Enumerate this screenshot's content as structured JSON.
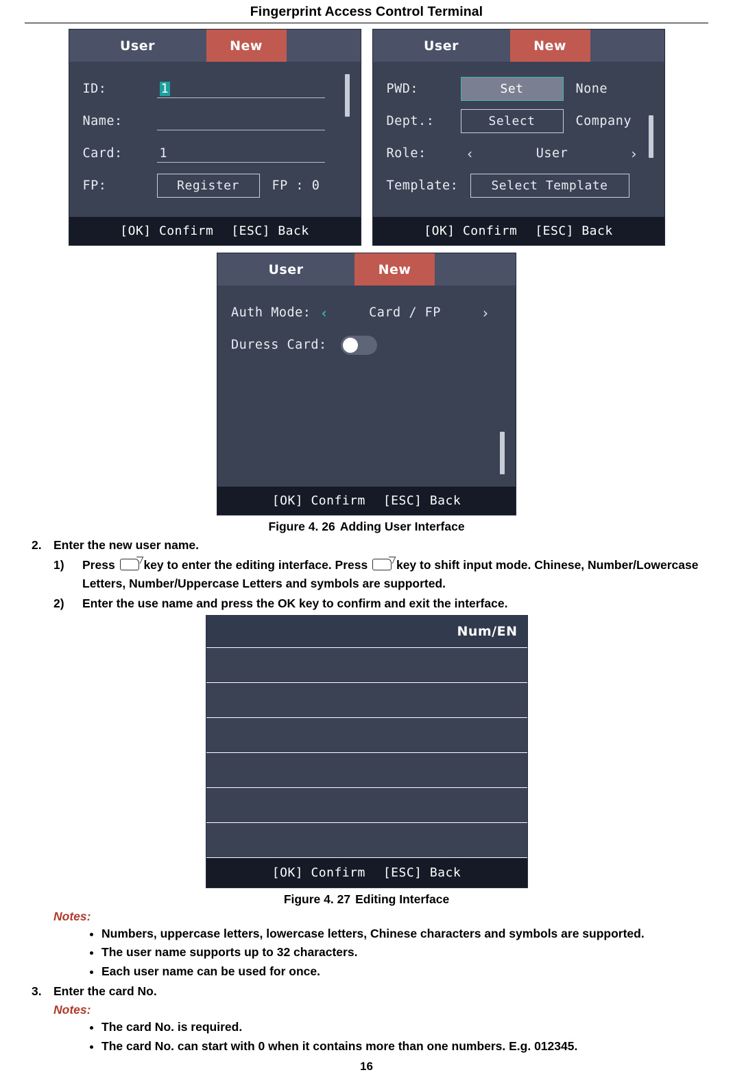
{
  "header": {
    "title": "Fingerprint Access Control Terminal"
  },
  "screens": {
    "screen1": {
      "tab_user": "User",
      "tab_new": "New",
      "fields": [
        {
          "label": "ID:",
          "value": "1"
        },
        {
          "label": "Name:",
          "value": ""
        },
        {
          "label": "Card:",
          "value": "1"
        }
      ],
      "fp_label": "FP:",
      "fp_button": "Register",
      "fp_count": "FP : 0",
      "footer_ok": "[OK] Confirm",
      "footer_esc": "[ESC] Back"
    },
    "screen2": {
      "tab_user": "User",
      "tab_new": "New",
      "pwd_label": "PWD:",
      "pwd_button": "Set",
      "pwd_value": "None",
      "dept_label": "Dept.:",
      "dept_button": "Select",
      "dept_value": "Company",
      "role_label": "Role:",
      "role_value": "User",
      "template_label": "Template:",
      "template_button": "Select Template",
      "footer_ok": "[OK] Confirm",
      "footer_esc": "[ESC] Back"
    },
    "screen3": {
      "tab_user": "User",
      "tab_new": "New",
      "auth_label": "Auth Mode:",
      "auth_value": "Card / FP",
      "duress_label": "Duress Card:",
      "footer_ok": "[OK] Confirm",
      "footer_esc": "[ESC] Back"
    }
  },
  "figures": {
    "fig26": {
      "num": "Figure 4. 26",
      "title": "Adding User Interface"
    },
    "fig27": {
      "num": "Figure 4. 27",
      "title": "Editing Interface"
    }
  },
  "steps": {
    "step2": {
      "marker": "2.",
      "text": "Enter the new user name."
    },
    "sub1": {
      "marker": "1)",
      "part1": "Press",
      "part2": "key to enter the editing interface. Press",
      "part3": "key to shift input mode. Chinese, Number/Lowercase Letters, Number/Uppercase Letters and symbols are supported."
    },
    "sub2": {
      "marker": "2)",
      "text": "Enter the use name and press the OK key to confirm and exit the interface."
    },
    "step3": {
      "marker": "3.",
      "text": "Enter the card No."
    }
  },
  "notes1": {
    "label": "Notes:",
    "items": [
      "Numbers, uppercase letters, lowercase letters, Chinese characters and symbols are supported.",
      "The user name supports up to 32 characters.",
      "Each user name can be used for once."
    ]
  },
  "notes2": {
    "label": "Notes:",
    "items": [
      "The card No. is required.",
      "The card No. can start with 0 when it contains more than one numbers. E.g. 012345."
    ]
  },
  "keyboard": {
    "mode_label": "Num/EN",
    "footer_ok": "[OK] Confirm",
    "footer_esc": "[ESC] Back"
  },
  "page_number": "16"
}
